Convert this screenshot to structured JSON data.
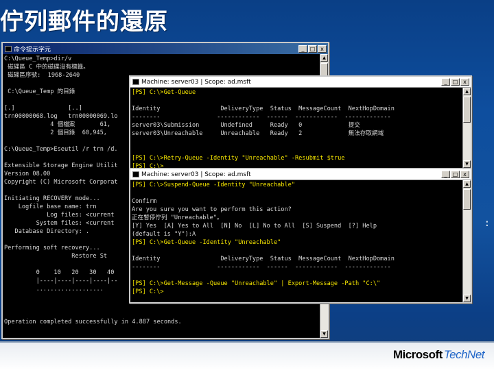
{
  "slide": {
    "title": "佇列郵件的還原",
    "brand_microsoft": "Microsoft",
    "brand_technet": "TechNet",
    "edge_mark": ":"
  },
  "window1": {
    "title": "命令提示字元",
    "lines": [
      "C:\\Queue_Temp>dir/v",
      " 磁碟區 C 中的磁碟沒有標籤。",
      " 磁碟區序號:  1968-2640",
      "",
      " C:\\Queue_Temp 的目錄",
      "",
      "[.]               [..]",
      "trn00000068.log   trn00000069.lo",
      "             4 個檔案       61,",
      "             2 個目錄  60,945,",
      "",
      "C:\\Queue_Temp>Eseutil /r trn /d.",
      "",
      "Extensible Storage Engine Utilit",
      "Version 08.00",
      "Copyright (C) Microsoft Corporat",
      "",
      "Initiating RECOVERY mode...",
      "    Logfile base name: trn",
      "            Log files: <current",
      "         System files: <current",
      "   Database Directory: .",
      "",
      "Performing soft recovery...",
      "                   Restore St",
      "",
      "         0    10   20   30   40",
      "         |----|----|----|----|--",
      "         ...................",
      "",
      "",
      "",
      "Operation completed successfully in 4.887 seconds.",
      "",
      "",
      ""
    ]
  },
  "window2": {
    "title": "Machine: server03 | Scope: ad.msft",
    "lines": [
      "[PS] C:\\>Get-Queue",
      "",
      "Identity                 DeliveryType  Status  MessageCount  NextHopDomain",
      "--------                ------------  ------  ------------  -------------",
      "server03\\Submission      Undefined     Ready   0             提交",
      "server03\\Unreachable     Unreachable   Ready   2             無法存取網域",
      "",
      "",
      "[PS] C:\\>Retry-Queue -Identity \"Unreachable\" -Resubmit $true",
      "[PS] C:\\>"
    ]
  },
  "window3": {
    "title": "Machine: server03 | Scope: ad.msft",
    "lines": [
      "[PS] C:\\>Suspend-Queue -Identity \"Unreachable\"",
      "",
      "Confirm",
      "Are you sure you want to perform this action?",
      "正在暫停佇列 \"Unreachable\"。",
      "[Y] Yes  [A] Yes to All  [N] No  [L] No to All  [S] Suspend  [?] Help",
      "(default is \"Y\"):A",
      "[PS] C:\\>Get-Queue -Identity \"Unreachable\"",
      "",
      "Identity                 DeliveryType  Status  MessageCount  NextHopDomain",
      "--------                ------------  ------  ------------  -------------",
      "",
      "[PS] C:\\>Get-Message -Queue \"Unreachable\" | Export-Message -Path \"C:\\\"",
      "[PS] C:\\>"
    ]
  },
  "controls": {
    "minimize": "_",
    "maximize": "□",
    "close": "x",
    "scroll_up": "▲",
    "scroll_down": "▼"
  },
  "colors": {
    "background": "#0e4e9e",
    "titlebar_active": "#0a246a",
    "console_bg": "#000000",
    "console_text": "#d8d8d8",
    "highlight_text": "#f5e500"
  }
}
